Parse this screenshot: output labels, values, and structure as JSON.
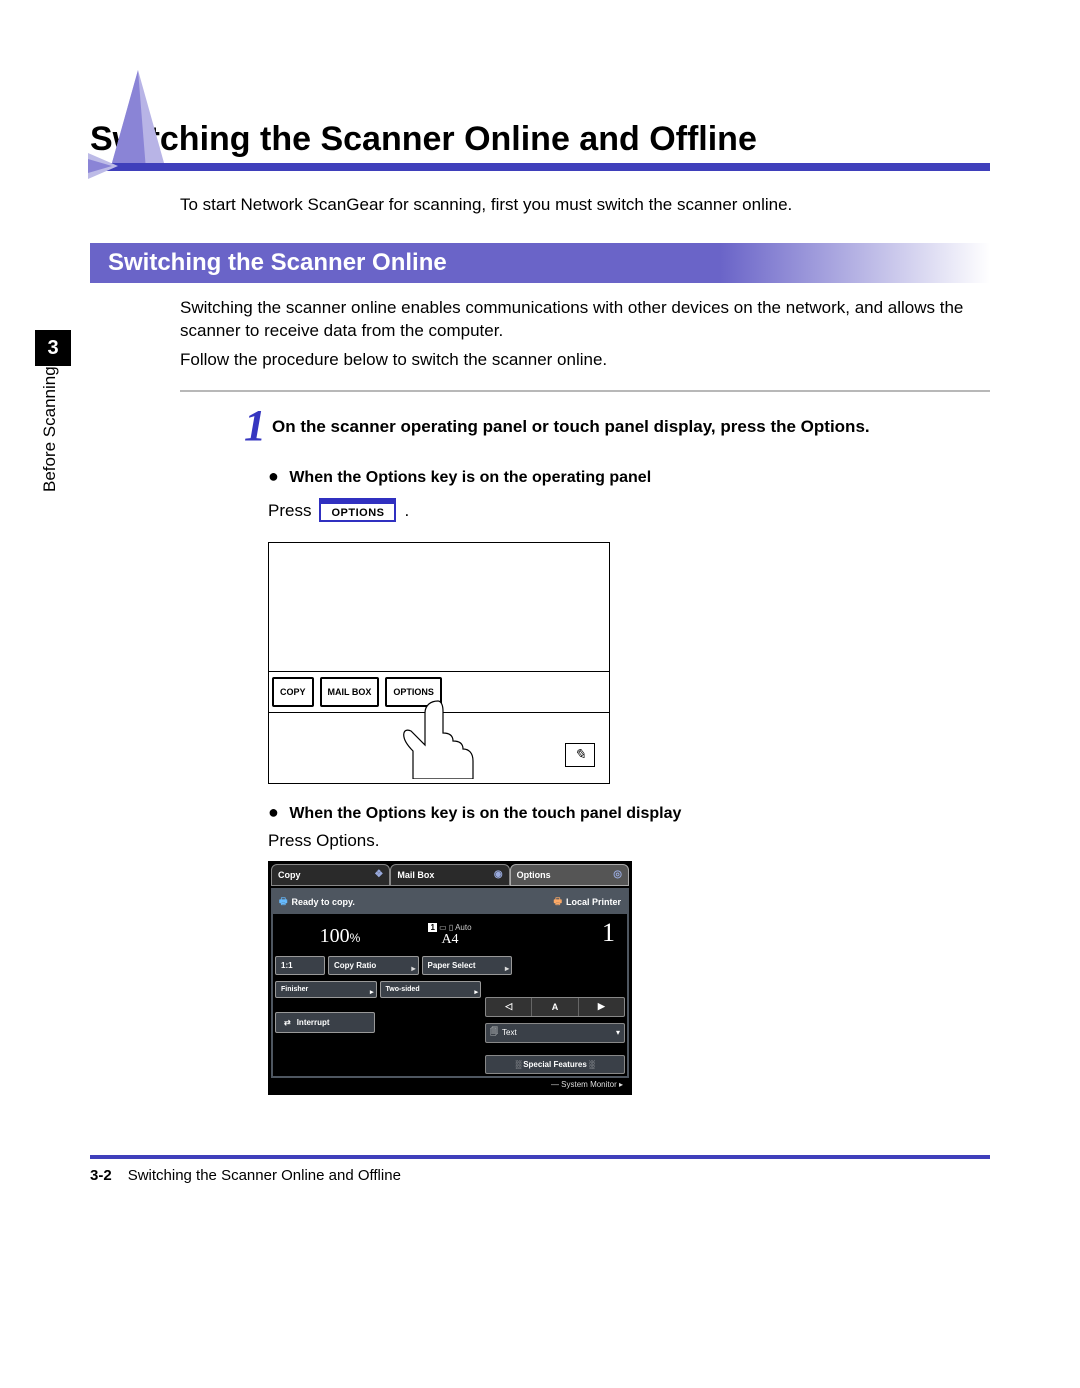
{
  "sidebar": {
    "chapter_number": "3",
    "chapter_label": "Before Scanning"
  },
  "main_title": "Switching the Scanner Online and Offline",
  "intro": "To start Network ScanGear for scanning, first you must switch the scanner online.",
  "section": {
    "heading": "Switching the Scanner Online",
    "p1": "Switching the scanner online enables communications with other devices on the network, and allows the scanner to receive data from the computer.",
    "p2": "Follow the procedure below to switch the scanner online."
  },
  "step1": {
    "number": "1",
    "text": "On the scanner operating panel or touch panel display, press the Options."
  },
  "bullet1": {
    "heading": "When the Options key is on the operating panel",
    "press_word": "Press",
    "button_label": "OPTIONS",
    "period": "."
  },
  "panel": {
    "btn_copy": "COPY",
    "btn_mailbox": "MAIL BOX",
    "btn_options": "OPTIONS",
    "light_glyph": "✎"
  },
  "bullet2": {
    "heading": "When the Options key is on the touch panel display",
    "press_text": "Press Options."
  },
  "touch": {
    "tabs": {
      "copy": "Copy",
      "mailbox": "Mail Box",
      "options": "Options"
    },
    "status": {
      "ready": "Ready to copy.",
      "local_printer": "Local Printer"
    },
    "info": {
      "zoom": "100",
      "zoom_unit": "%",
      "paper_auto": "Auto",
      "paper_size": "A4",
      "copies": "1",
      "btn_11": "1:1",
      "btn_ratio": "Copy Ratio",
      "btn_paper": "Paper Select"
    },
    "lower": {
      "finisher": "Finisher",
      "twosided": "Two-sided",
      "interrupt": "Interrupt",
      "seg_center": "A",
      "text_label": "Text",
      "special": "Special Features",
      "system_monitor": "System Monitor"
    }
  },
  "footer": {
    "page_number": "3-2",
    "title": "Switching the Scanner Online and Offline"
  }
}
